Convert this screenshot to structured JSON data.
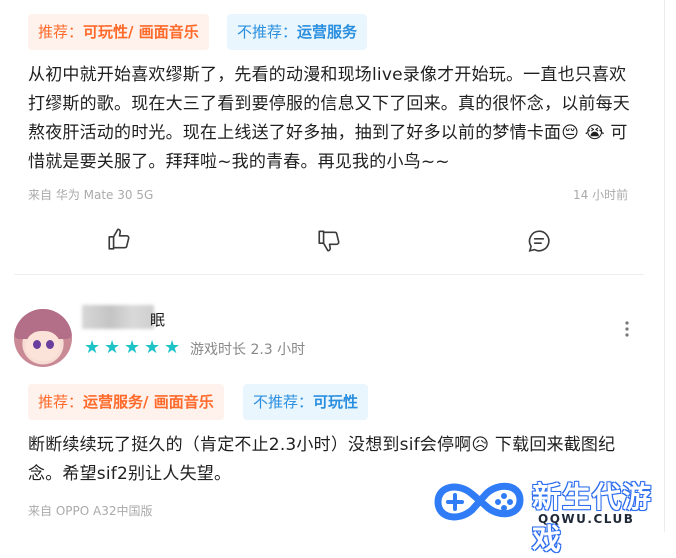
{
  "review1": {
    "tag_rec_prefix": "推荐：",
    "tag_rec_value": "可玩性/ 画面音乐",
    "tag_notrec_prefix": "不推荐：",
    "tag_notrec_value": "运营服务",
    "text": "从初中就开始喜欢缪斯了，先看的动漫和现场live录像才开始玩。一直也只喜欢打缪斯的歌。现在大三了看到要停服的信息又下了回来。真的很怀念，以前每天熬夜肝活动的时光。现在上线送了好多抽，抽到了好多以前的梦情卡面😔 😭 可惜就是要关服了。拜拜啦~我的青春。再见我的小鸟~~",
    "device": "来自 华为 Mate 30 5G",
    "time": "14 小时前",
    "icons": [
      "thumbs-up-icon",
      "thumbs-down-icon",
      "comment-icon"
    ]
  },
  "review2": {
    "username_tail": "眠",
    "rating": 5,
    "playtime": "游戏时长 2.3 小时",
    "tag_rec_prefix": "推荐：",
    "tag_rec_value": "运营服务/ 画面音乐",
    "tag_notrec_prefix": "不推荐：",
    "tag_notrec_value": "可玩性",
    "text": "断断续续玩了挺久的（肯定不止2.3小时）没想到sif会停啊😥 下载回来截图纪念。希望sif2别让人失望。",
    "device": "来自 OPPO A32中国版"
  },
  "watermark": {
    "name": "新生代游戏",
    "domain": "QQWU.CLUB"
  },
  "colors": {
    "rec_bg": "#fff2ec",
    "rec_text": "#ff6a2b",
    "notrec_bg": "#eaf6fd",
    "notrec_text": "#2b8fe0",
    "star": "#1ec3c8"
  }
}
